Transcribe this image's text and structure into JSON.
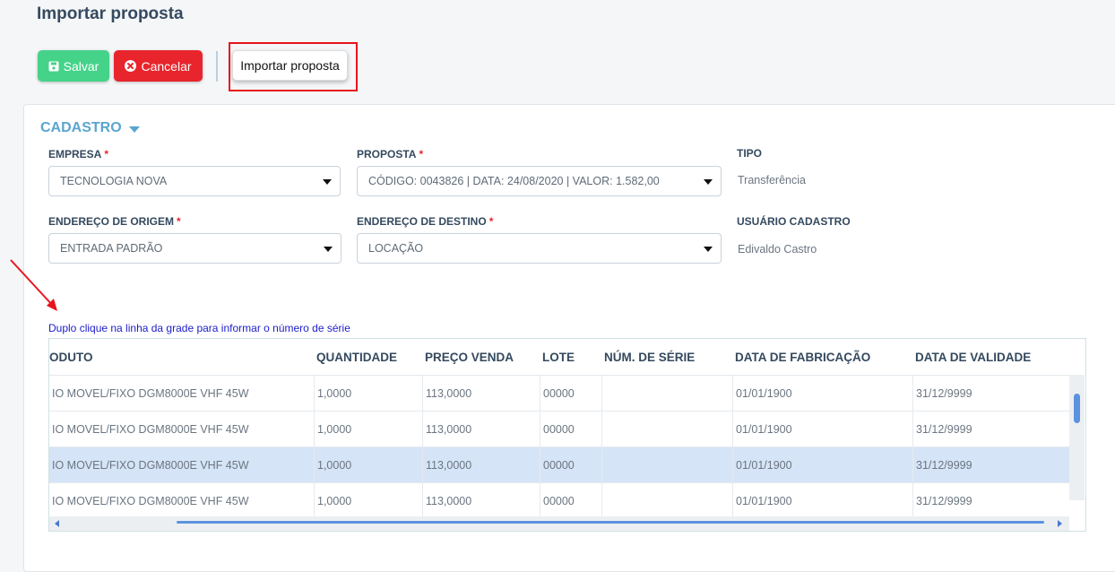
{
  "page": {
    "title": "Importar proposta"
  },
  "toolbar": {
    "save_label": "Salvar",
    "cancel_label": "Cancelar",
    "import_label": "Importar proposta"
  },
  "section": {
    "title": "CADASTRO"
  },
  "form": {
    "empresa": {
      "label": "EMPRESA",
      "required": "*",
      "value": "TECNOLOGIA NOVA"
    },
    "proposta": {
      "label": "PROPOSTA",
      "required": "*",
      "value": "CÓDIGO: 0043826 | DATA: 24/08/2020 | VALOR: 1.582,00"
    },
    "tipo": {
      "label": "TIPO",
      "value": "Transferência"
    },
    "endereco_origem": {
      "label": "ENDEREÇO DE ORIGEM",
      "required": "*",
      "value": "ENTRADA PADRÃO"
    },
    "endereco_destino": {
      "label": "ENDEREÇO DE DESTINO",
      "required": "*",
      "value": "LOCAÇÃO"
    },
    "usuario_cadastro": {
      "label": "USUÁRIO CADASTRO",
      "value": "Edivaldo Castro"
    }
  },
  "grid": {
    "hint": "Duplo clique na linha da grade para informar o número de série",
    "columns": [
      "ODUTO",
      "QUANTIDADE",
      "PREÇO VENDA",
      "LOTE",
      "NÚM. DE SÉRIE",
      "DATA DE FABRICAÇÃO",
      "DATA DE VALIDADE"
    ],
    "rows": [
      [
        "IO MOVEL/FIXO DGM8000E VHF 45W",
        "1,0000",
        "113,0000",
        "00000",
        "",
        "01/01/1900",
        "31/12/9999"
      ],
      [
        "IO MOVEL/FIXO DGM8000E VHF 45W",
        "1,0000",
        "113,0000",
        "00000",
        "",
        "01/01/1900",
        "31/12/9999"
      ],
      [
        "IO MOVEL/FIXO DGM8000E VHF 45W",
        "1,0000",
        "113,0000",
        "00000",
        "",
        "01/01/1900",
        "31/12/9999"
      ],
      [
        "IO MOVEL/FIXO DGM8000E VHF 45W",
        "1,0000",
        "113,0000",
        "00000",
        "",
        "01/01/1900",
        "31/12/9999"
      ]
    ],
    "selected_row": 2
  },
  "colors": {
    "save": "#45d38a",
    "cancel": "#e8252c",
    "accent": "#5aa5cf",
    "selected_row": "#d6e4f7",
    "annotation": "#e8141c"
  }
}
